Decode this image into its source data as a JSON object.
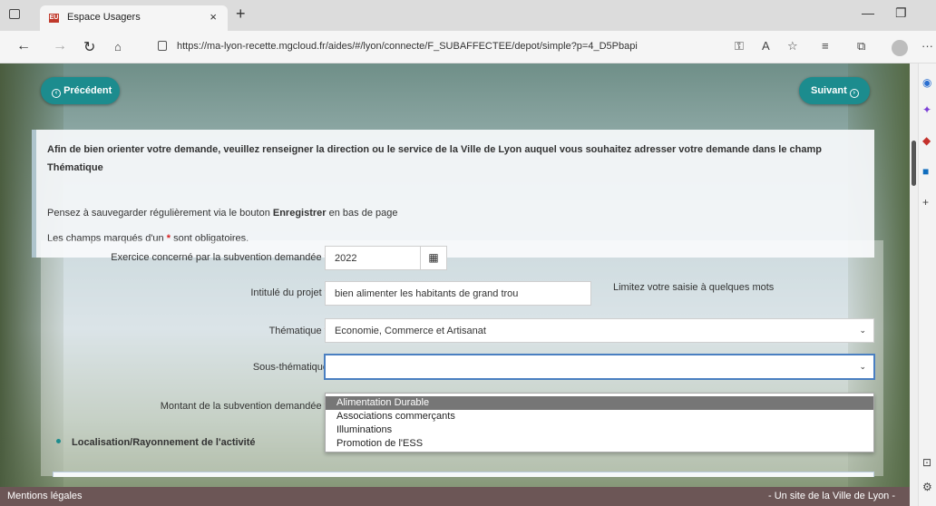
{
  "browser": {
    "tab_title": "Espace Usagers",
    "tab_favicon_text": "EU",
    "tab_close": "×",
    "new_tab": "+",
    "url": "https://ma-lyon-recette.mgcloud.fr/aides/#/lyon/connecte/F_SUBAFFECTEE/depot/simple?p=4_D5Pbapi",
    "icons": [
      "window-icon",
      "back-icon",
      "forward-icon",
      "refresh-icon",
      "home-icon",
      "lock-icon",
      "key-icon",
      "read-aloud-icon",
      "favorite-icon",
      "favorites-icon",
      "collections-icon",
      "profile-icon",
      "more-icon",
      "minimize-icon",
      "restore-icon",
      "close-icon"
    ],
    "minimize": "—",
    "restore": "❐",
    "more": "···"
  },
  "nav": {
    "previous_label": "Précédent",
    "next_label": "Suivant"
  },
  "notice": {
    "main_text": "Afin de bien orienter votre demande, veuillez renseigner la direction ou le service de la Ville de Lyon auquel vous souhaitez adresser votre demande dans le champ Thématique",
    "save_prefix": "Pensez à sauvegarder régulièrement via le bouton ",
    "save_button_name": "Enregistrer",
    "save_suffix": " en bas de page",
    "required_prefix": "Les champs marqués d'un ",
    "required_star": "*",
    "required_suffix": " sont obligatoires."
  },
  "form": {
    "exercice": {
      "label": "Exercice concerné par la subvention demandée",
      "value": "2022",
      "required": "*"
    },
    "intitule": {
      "label": "Intitulé du projet",
      "value": "bien alimenter les habitants de grand trou",
      "required": "*",
      "hint": "Limitez votre saisie à quelques mots"
    },
    "thematique": {
      "label": "Thématique",
      "value": "Economie, Commerce et Artisanat",
      "required": "*"
    },
    "sous_thematique": {
      "label": "Sous-thématique",
      "value": ""
    },
    "montant": {
      "label": "Montant de la subvention demandée",
      "required": "*"
    },
    "sous_thematique_options": [
      "Alimentation Durable",
      "Associations commerçants",
      "Illuminations",
      "Promotion de l'ESS"
    ],
    "selected_option": "Alimentation Durable",
    "section_localisation": "Localisation/Rayonnement de l'activité"
  },
  "footer": {
    "left": "Mentions légales",
    "right": "- Un site de la Ville de Lyon -"
  },
  "colors": {
    "accent": "#1c8c8e",
    "required": "#d62020",
    "footer_bg": "#6c5656",
    "dropdown_selected": "#767676"
  }
}
